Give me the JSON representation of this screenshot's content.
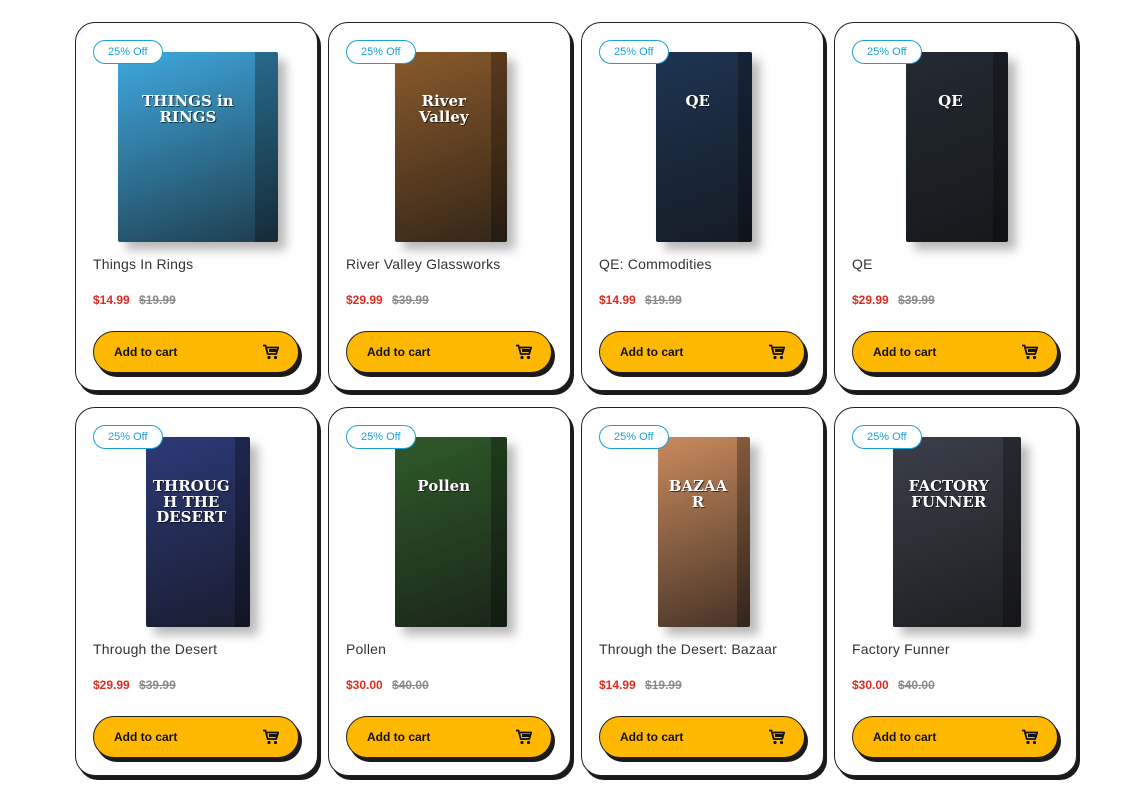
{
  "products": [
    {
      "badge": "25% Off",
      "title": "Things In Rings",
      "price": "$14.99",
      "old_price": "$19.99",
      "cart_label": "Add to cart",
      "box_text": "THINGS in RINGS",
      "box_width": 160,
      "box_color": "#3fa9e0"
    },
    {
      "badge": "25% Off",
      "title": "River Valley Glassworks",
      "price": "$29.99",
      "old_price": "$39.99",
      "cart_label": "Add to cart",
      "box_text": "River Valley",
      "box_width": 112,
      "box_color": "#8a5a2b"
    },
    {
      "badge": "25% Off",
      "title": "QE: Commodities",
      "price": "$14.99",
      "old_price": "$19.99",
      "cart_label": "Add to cart",
      "box_text": "QE",
      "box_width": 96,
      "box_color": "#1d3552"
    },
    {
      "badge": "25% Off",
      "title": "QE",
      "price": "$29.99",
      "old_price": "$39.99",
      "cart_label": "Add to cart",
      "box_text": "QE",
      "box_width": 102,
      "box_color": "#232a33"
    },
    {
      "badge": "25% Off",
      "title": "Through the Desert",
      "price": "$29.99",
      "old_price": "$39.99",
      "cart_label": "Add to cart",
      "box_text": "THROUGH THE DESERT",
      "box_width": 104,
      "box_color": "#2c3a78"
    },
    {
      "badge": "25% Off",
      "title": "Pollen",
      "price": "$30.00",
      "old_price": "$40.00",
      "cart_label": "Add to cart",
      "box_text": "Pollen",
      "box_width": 112,
      "box_color": "#2f5a2a"
    },
    {
      "badge": "25% Off",
      "title": "Through the Desert: Bazaar",
      "price": "$14.99",
      "old_price": "$19.99",
      "cart_label": "Add to cart",
      "box_text": "BAZAAR",
      "box_width": 92,
      "box_color": "#c98a5d"
    },
    {
      "badge": "25% Off",
      "title": "Factory Funner",
      "price": "$30.00",
      "old_price": "$40.00",
      "cart_label": "Add to cart",
      "box_text": "FACTORY FUNNER",
      "box_width": 128,
      "box_color": "#3b3f4a"
    }
  ],
  "theme": {
    "accent": "#ffb800",
    "sale_price": "#e02b1f",
    "badge": "#1aa3d9"
  },
  "icons": {
    "cart": "cart-icon"
  }
}
